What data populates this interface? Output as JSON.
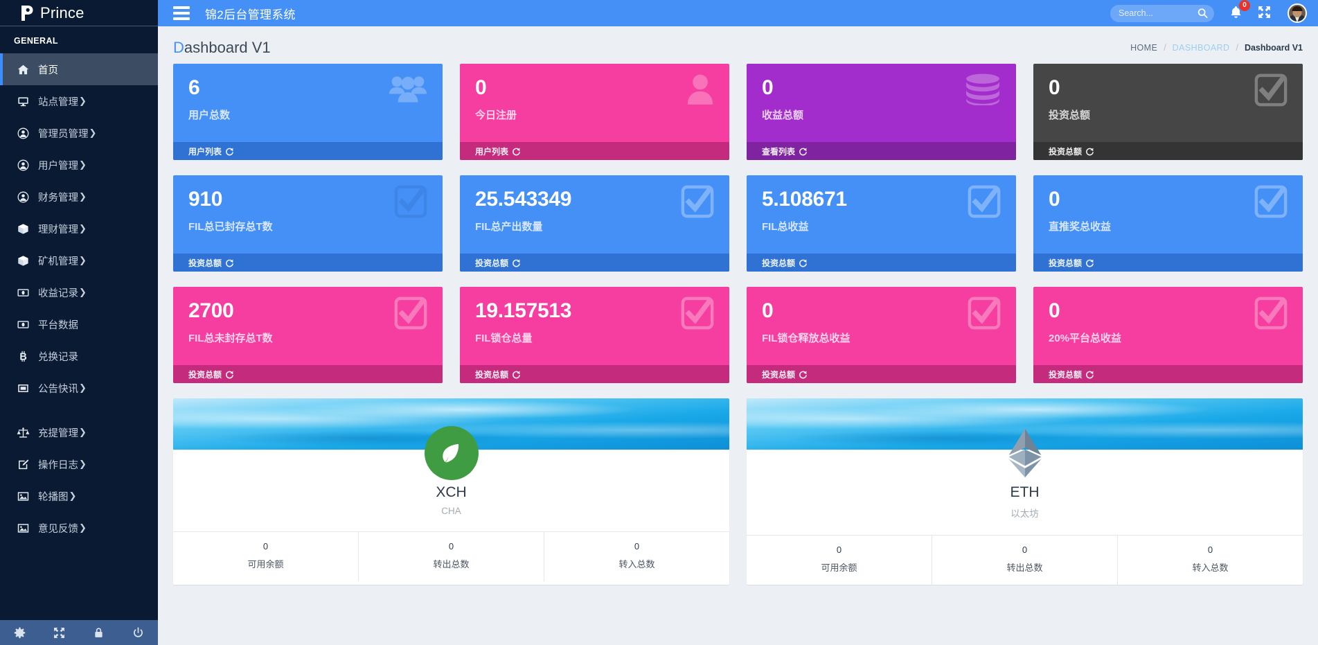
{
  "brand": {
    "name": "Prince",
    "logo_icon": "p-logo-icon"
  },
  "sidebar": {
    "section_label": "GENERAL",
    "items": [
      {
        "label": "首页",
        "icon": "home-icon",
        "caret": "",
        "active": true
      },
      {
        "label": "站点管理",
        "icon": "monitor-icon",
        "caret": "❯",
        "active": false
      },
      {
        "label": "管理员管理",
        "icon": "user-circle-icon",
        "caret": "❯",
        "active": false
      },
      {
        "label": "用户管理",
        "icon": "user-circle-icon",
        "caret": "❯",
        "active": false
      },
      {
        "label": "财务管理",
        "icon": "user-circle-icon",
        "caret": "❯",
        "active": false
      },
      {
        "label": "理财管理",
        "icon": "box-icon",
        "caret": "❯",
        "active": false
      },
      {
        "label": "矿机管理",
        "icon": "box-icon",
        "caret": "❯",
        "active": false
      },
      {
        "label": "收益记录",
        "icon": "money-icon",
        "caret": "❯",
        "active": false
      },
      {
        "label": "平台数据",
        "icon": "money-icon",
        "caret": "",
        "active": false
      },
      {
        "label": "兑换记录",
        "icon": "bitcoin-icon",
        "caret": "",
        "active": false
      },
      {
        "label": "公告快讯",
        "icon": "window-icon",
        "caret": "❯",
        "active": false
      },
      {
        "label": "充提管理",
        "icon": "balance-scale-icon",
        "caret": "❯",
        "active": false
      },
      {
        "label": "操作日志",
        "icon": "edit-square-icon",
        "caret": "❯",
        "active": false
      },
      {
        "label": "轮播图",
        "icon": "image-icon",
        "caret": "❯",
        "active": false
      },
      {
        "label": "意见反馈",
        "icon": "image-icon",
        "caret": "❯",
        "active": false
      }
    ],
    "footer_buttons": [
      {
        "name": "settings",
        "icon": "gear-icon"
      },
      {
        "name": "fullscreen",
        "icon": "expand-arrows-icon"
      },
      {
        "name": "lock",
        "icon": "lock-icon"
      },
      {
        "name": "logout",
        "icon": "power-icon"
      }
    ]
  },
  "topbar": {
    "menu_toggle_icon": "hamburger-icon",
    "title": "锦2后台管理系统",
    "search": {
      "placeholder": "Search...",
      "value": "",
      "icon": "search-icon"
    },
    "notifications": {
      "count": "0",
      "icon": "bell-icon"
    },
    "fullscreen_icon": "expand-icon",
    "avatar_icon": "avatar"
  },
  "page": {
    "title_first": "D",
    "title_rest": "ashboard V1",
    "breadcrumb": [
      {
        "label": "HOME",
        "type": "plain"
      },
      {
        "label": "DASHBOARD",
        "type": "link"
      },
      {
        "label": "Dashboard V1",
        "type": "current"
      }
    ],
    "separator": "/"
  },
  "stat_rows": [
    [
      {
        "value": "6",
        "label": "用户总数",
        "footer": "用户列表",
        "icon": "users-icon",
        "bg": "#4590f7",
        "foot_bg": "#2f72d4",
        "icon_color": "#ffffff",
        "icon_opacity": 0.85
      },
      {
        "value": "0",
        "label": "今日注册",
        "footer": "用户列表",
        "icon": "user-icon",
        "bg": "#f63ea0",
        "foot_bg": "#c42b7d",
        "icon_color": "#ffffff",
        "icon_opacity": 0.85
      },
      {
        "value": "0",
        "label": "收益总额",
        "footer": "查看列表",
        "icon": "database-icon",
        "bg": "#a32dcc",
        "foot_bg": "#7f23a0",
        "icon_color": "#ffffff",
        "icon_opacity": 0.85
      },
      {
        "value": "0",
        "label": "投资总额",
        "footer": "投资总额",
        "icon": "check-square-icon",
        "bg": "#464646",
        "foot_bg": "#343434",
        "icon_color": "#ffffff",
        "icon_opacity": 0.95
      }
    ],
    [
      {
        "value": "910",
        "label": "FIL总已封存总T数",
        "footer": "投资总额",
        "icon": "check-square-icon",
        "bg": "#4590f7",
        "foot_bg": "#2f72d4",
        "icon_color": "#2f6fc6",
        "icon_opacity": 1
      },
      {
        "value": "25.543349",
        "label": "FIL总产出数量",
        "footer": "投资总额",
        "icon": "check-square-icon",
        "bg": "#4590f7",
        "foot_bg": "#2f72d4",
        "icon_color": "#ffffff",
        "icon_opacity": 0.95
      },
      {
        "value": "5.108671",
        "label": "FIL总收益",
        "footer": "投资总额",
        "icon": "check-square-icon",
        "bg": "#4590f7",
        "foot_bg": "#2f72d4",
        "icon_color": "#ffffff",
        "icon_opacity": 0.95
      },
      {
        "value": "0",
        "label": "直推奖总收益",
        "footer": "投资总额",
        "icon": "check-square-icon",
        "bg": "#4590f7",
        "foot_bg": "#2f72d4",
        "icon_color": "#ffffff",
        "icon_opacity": 0.95
      }
    ],
    [
      {
        "value": "2700",
        "label": "FIL总未封存总T数",
        "footer": "投资总额",
        "icon": "check-square-icon",
        "bg": "#f63ea0",
        "foot_bg": "#c42b7d",
        "icon_color": "#ffffff",
        "icon_opacity": 0.95
      },
      {
        "value": "19.157513",
        "label": "FIL锁仓总量",
        "footer": "投资总额",
        "icon": "check-square-icon",
        "bg": "#f63ea0",
        "foot_bg": "#c42b7d",
        "icon_color": "#ffffff",
        "icon_opacity": 0.95
      },
      {
        "value": "0",
        "label": "FIL锁仓释放总收益",
        "footer": "投资总额",
        "icon": "check-square-icon",
        "bg": "#f63ea0",
        "foot_bg": "#c42b7d",
        "icon_color": "#ffffff",
        "icon_opacity": 0.95
      },
      {
        "value": "0",
        "label": "20%平台总收益",
        "footer": "投资总额",
        "icon": "check-square-icon",
        "bg": "#f63ea0",
        "foot_bg": "#c42b7d",
        "icon_color": "#ffffff",
        "icon_opacity": 0.95
      }
    ]
  ],
  "coins": [
    {
      "name": "XCH",
      "sub": "CHA",
      "logo_icon": "chia-leaf-icon",
      "logo_color": "#3f9c42",
      "stats": [
        {
          "value": "0",
          "label": "可用余额"
        },
        {
          "value": "0",
          "label": "转出总数"
        },
        {
          "value": "0",
          "label": "转入总数"
        }
      ]
    },
    {
      "name": "ETH",
      "sub": "以太坊",
      "logo_icon": "ethereum-icon",
      "logo_color": "#8294a6",
      "stats": [
        {
          "value": "0",
          "label": "可用余额"
        },
        {
          "value": "0",
          "label": "转出总数"
        },
        {
          "value": "0",
          "label": "转入总数"
        }
      ]
    }
  ]
}
